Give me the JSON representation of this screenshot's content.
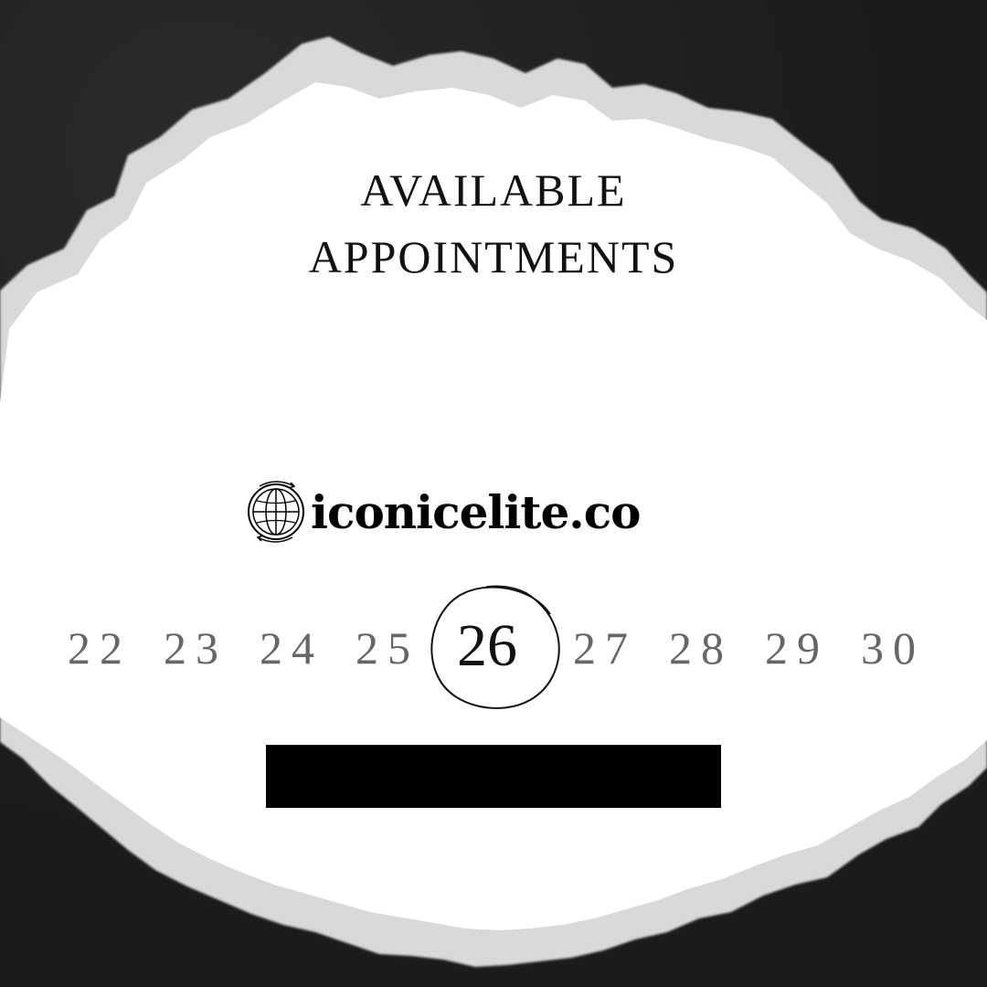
{
  "heading": {
    "line1": "AVAILABLE",
    "line2": "APPOINTMENTS"
  },
  "brand": {
    "icon": "globe-icon",
    "text": "iconicelite.co"
  },
  "dates": {
    "items": [
      "22",
      "23",
      "24",
      "25",
      "26",
      "27",
      "28",
      "29",
      "30"
    ],
    "selected": "26"
  },
  "colors": {
    "background": "#1f1f1f",
    "paper": "#ffffff",
    "text": "#111111",
    "muted": "#666666",
    "redaction": "#000000"
  }
}
